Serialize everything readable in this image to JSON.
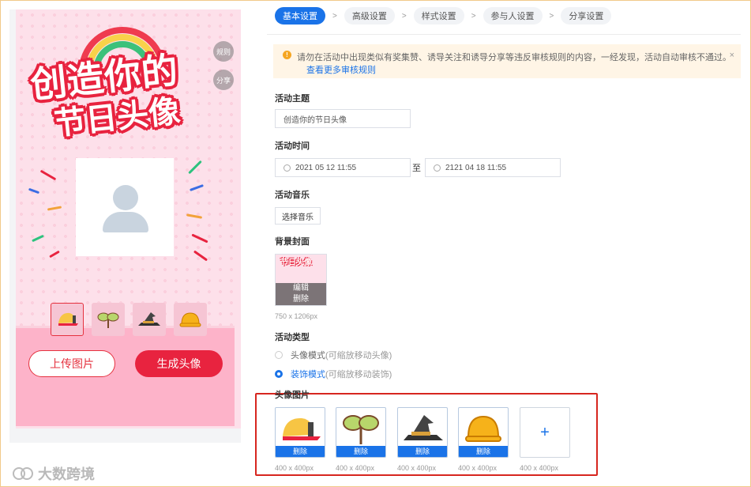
{
  "preview": {
    "title_line1": "创造你的",
    "title_line2": "节日头像",
    "rules_btn": "规则",
    "share_btn": "分享",
    "upload_btn": "上传图片",
    "generate_btn": "生成头像"
  },
  "tabs": [
    "基本设置",
    "高级设置",
    "样式设置",
    "参与人设置",
    "分享设置"
  ],
  "tab_separator": ">",
  "notice": {
    "message": "请勿在活动中出现类似有奖集赞、诱导关注和诱导分享等违反审核规则的内容，一经发现，活动自动审核不通过。",
    "link": "查看更多审核规则",
    "close": "×"
  },
  "form": {
    "title_label": "活动主题",
    "title_value": "创造你的节日头像",
    "time_label": "活动时间",
    "start_time": "2021 05 12 11:55",
    "time_to": "至",
    "end_time": "2121 04 18 11:55",
    "music_label": "活动音乐",
    "music_btn": "选择音乐",
    "cover_label": "背景封面",
    "cover_thumb_text": "节日头像",
    "cover_edit": "编辑",
    "cover_delete": "删除",
    "cover_size": "750 x 1206px",
    "type_label": "活动类型",
    "type_options": [
      {
        "label": "头像模式",
        "hint": "(可缩放移动头像)",
        "selected": false
      },
      {
        "label": "装饰模式",
        "hint": "(可缩放移动装饰)",
        "selected": true
      }
    ],
    "avatar_images_label": "头像图片",
    "avatar_images": [
      {
        "icon": "cap-icon",
        "delete": "删除",
        "size": "400 x 400px"
      },
      {
        "icon": "sprout-icon",
        "delete": "删除",
        "size": "400 x 400px"
      },
      {
        "icon": "witch-hat-icon",
        "delete": "删除",
        "size": "400 x 400px"
      },
      {
        "icon": "hard-hat-icon",
        "delete": "删除",
        "size": "400 x 400px"
      }
    ],
    "add_label": "+",
    "add_size": "400 x 400px"
  },
  "watermark": "大数跨境",
  "colors": {
    "accent": "#1a73e8",
    "brand_red": "#e8233f",
    "highlight": "#d7261f"
  }
}
